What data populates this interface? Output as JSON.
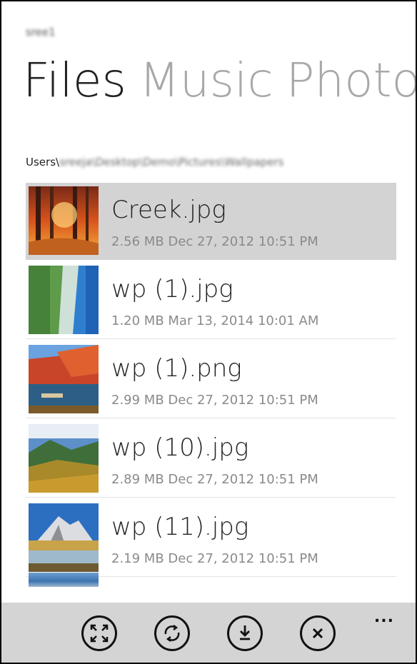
{
  "account": {
    "name": "sree1"
  },
  "pivot": {
    "items": [
      {
        "label": "Files",
        "active": true
      },
      {
        "label": "Music",
        "active": false
      },
      {
        "label": "Photos",
        "active": false
      }
    ]
  },
  "path": {
    "visible": "Users\\",
    "obscured": "sreeja\\Desktop\\Demo\\Pictures\\Wallpapers"
  },
  "files": [
    {
      "name": "Creek.jpg",
      "meta": "2.56 MB Dec 27, 2012 10:51 PM",
      "selected": true
    },
    {
      "name": "wp (1).jpg",
      "meta": "1.20 MB Mar 13, 2014 10:01 AM",
      "selected": false
    },
    {
      "name": "wp (1).png",
      "meta": "2.99 MB Dec 27, 2012 10:51 PM",
      "selected": false
    },
    {
      "name": "wp (10).jpg",
      "meta": "2.89 MB Dec 27, 2012 10:51 PM",
      "selected": false
    },
    {
      "name": "wp (11).jpg",
      "meta": "2.19 MB Dec 27, 2012 10:51 PM",
      "selected": false
    }
  ],
  "appbar": {
    "buttons": [
      {
        "icon": "fullscreen-icon"
      },
      {
        "icon": "sync-icon"
      },
      {
        "icon": "download-icon"
      },
      {
        "icon": "close-icon"
      }
    ],
    "more_label": "..."
  },
  "colors": {
    "appbar": "#d4d4d4",
    "selected_row": "#d3d3d3",
    "pivot_inactive": "#a8a8a8",
    "meta_text": "#8a8a8a"
  }
}
